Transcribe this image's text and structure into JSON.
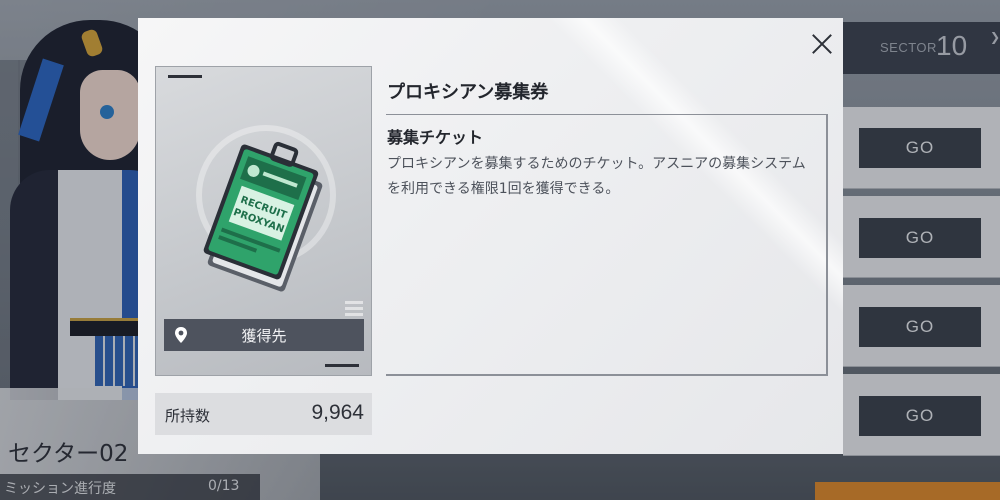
{
  "background": {
    "sector_label": "SECTOR",
    "sector_number": "10",
    "go_buttons": [
      "GO",
      "GO",
      "GO",
      "GO"
    ],
    "sector_name": "セクター02",
    "mission_progress_label": "ミッション進行度",
    "mission_progress_value": "0/13"
  },
  "modal": {
    "item": {
      "name": "プロキシアン募集券",
      "ticket_text_line1": "RECRUIT",
      "ticket_text_line2": "PROXYAN",
      "source_button_label": "獲得先",
      "owned_label": "所持数",
      "owned_count": "9,964"
    },
    "description": {
      "heading": "募集チケット",
      "body": "プロキシアンを募集するためのチケット。アスニアの募集システムを利用できる権限1回を獲得できる。"
    }
  },
  "icons": {
    "close": "close-icon",
    "source": "map-pin-icon",
    "sector_arrow": "chevron-right-icon"
  },
  "colors": {
    "ticket_green": "#2fa36b",
    "button_dark": "#3a404c",
    "accent_orange": "#e08a2a"
  }
}
